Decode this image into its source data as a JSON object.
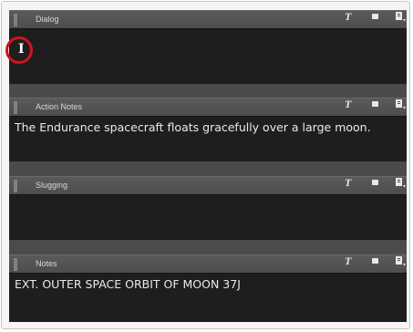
{
  "sections": [
    {
      "title": "Dialog",
      "text": ""
    },
    {
      "title": "Action Notes",
      "text": "The Endurance spacecraft floats gracefully over a large moon."
    },
    {
      "title": "Slugging",
      "text": ""
    },
    {
      "title": "Notes",
      "text": "EXT. OUTER SPACE ORBIT OF MOON 37J"
    }
  ],
  "toolbar": {
    "text_tool_glyph": "T"
  },
  "cursor": {
    "glyph": "I"
  },
  "colors": {
    "highlight_ring": "#d0141b",
    "panel_bg": "#1e1e1e",
    "header_bg": "#555555"
  },
  "icons": [
    "grip-icon",
    "text-tool-icon",
    "square-icon",
    "panel-menu-icon",
    "text-cursor-icon"
  ]
}
